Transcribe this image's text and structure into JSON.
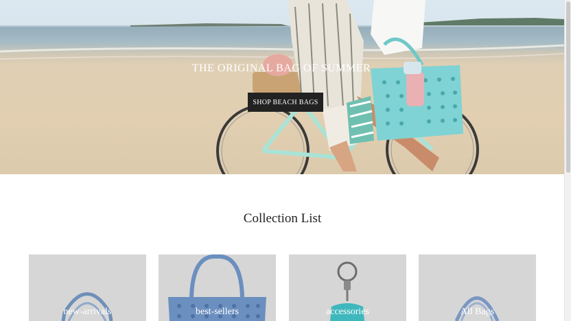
{
  "hero": {
    "title": "THE ORIGINAL BAG OF SUMMER",
    "cta_label": "SHOP BEACH BAGS"
  },
  "collection": {
    "heading": "Collection List",
    "items": [
      {
        "label": "new-arrivals"
      },
      {
        "label": "best-sellers"
      },
      {
        "label": "accessories"
      },
      {
        "label": "All Bags"
      }
    ]
  },
  "colors": {
    "cta_background": "#222222",
    "card_background": "#d6d6d6",
    "bag_teal": "#7fd3d4",
    "bag_blue": "#6b8fbf",
    "bike_mint": "#a9e3d6"
  }
}
